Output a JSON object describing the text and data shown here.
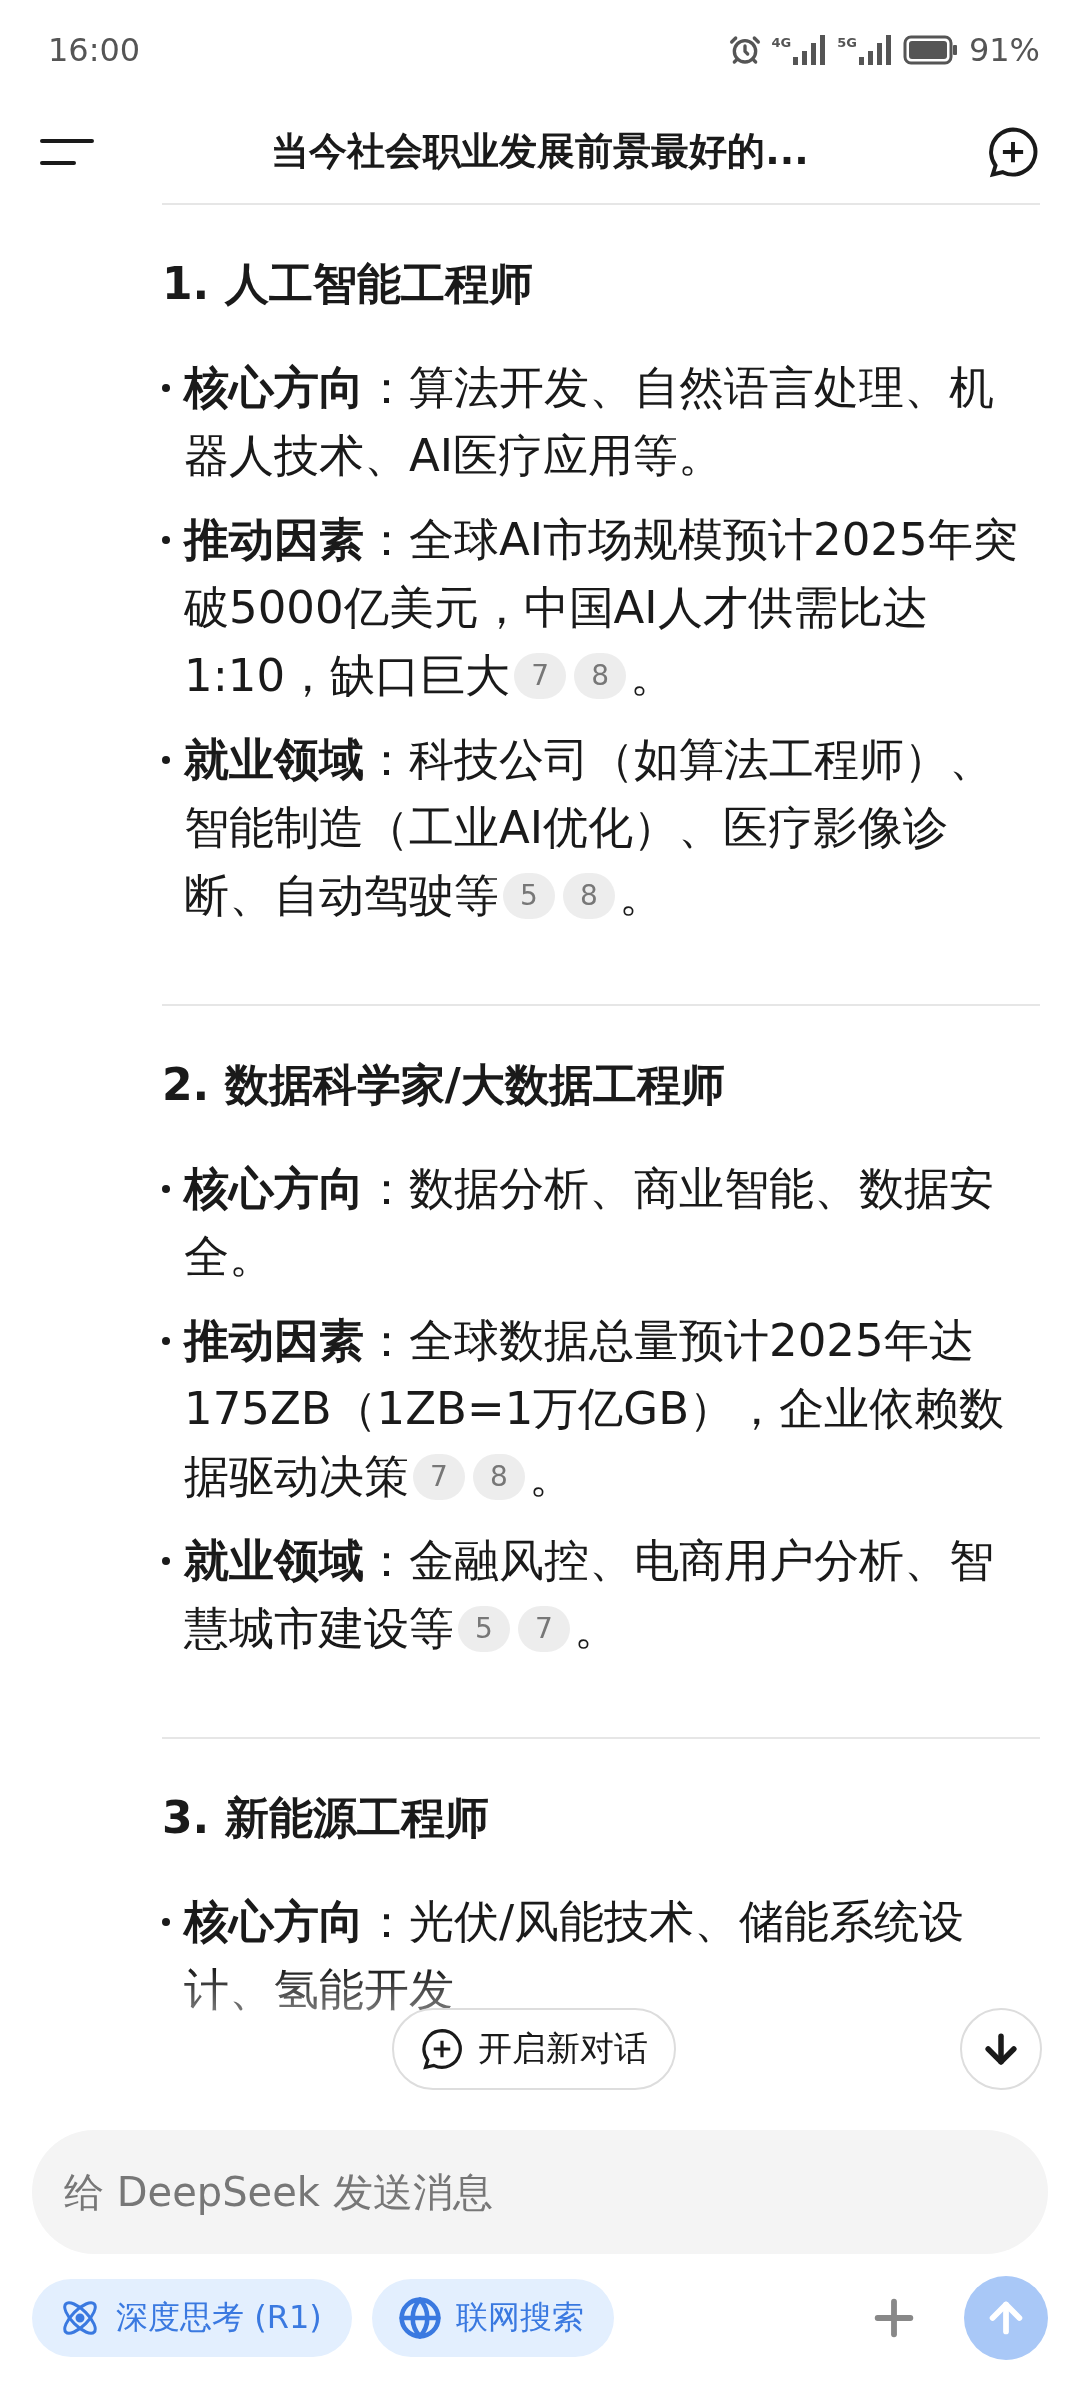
{
  "status_bar": {
    "time": "16:00",
    "signals": [
      {
        "label": "4G"
      },
      {
        "label": "5G"
      }
    ],
    "battery": "91%"
  },
  "header": {
    "title": "当今社会职业发展前景最好的..."
  },
  "sections": [
    {
      "heading": "1. 人工智能工程师",
      "items": [
        {
          "label": "核心方向",
          "text": "：算法开发、自然语言处理、机器人技术、AI医疗应用等。"
        },
        {
          "label": "推动因素",
          "text": "：全球AI市场规模预计2025年突破5000亿美元，中国AI人才供需比达1:10，缺口巨大",
          "citations": [
            "7",
            "8"
          ],
          "tail": "。"
        },
        {
          "label": "就业领域",
          "text": "：科技公司（如算法工程师）、智能制造（工业AI优化）、医疗影像诊断、自动驾驶等",
          "citations": [
            "5",
            "8"
          ],
          "tail": "。"
        }
      ]
    },
    {
      "heading": "2. 数据科学家/大数据工程师",
      "items": [
        {
          "label": "核心方向",
          "text": "：数据分析、商业智能、数据安全。"
        },
        {
          "label": "推动因素",
          "text": "：全球数据总量预计2025年达175ZB（1ZB=1万亿GB），企业依赖数据驱动决策",
          "citations": [
            "7",
            "8"
          ],
          "tail": "。"
        },
        {
          "label": "就业领域",
          "text": "：金融风控、电商用户分析、智慧城市建设等",
          "citations": [
            "5",
            "7"
          ],
          "tail": "。"
        }
      ]
    },
    {
      "heading": "3. 新能源工程师",
      "items": [
        {
          "label": "核心方向",
          "text": "：光伏/风能技术、储能系统设计、氢能开发"
        }
      ]
    }
  ],
  "new_chat_button": "开启新对话",
  "composer": {
    "placeholder": "给 DeepSeek 发送消息",
    "chips": [
      {
        "kind": "deepthink",
        "label": "深度思考 (R1)",
        "selected": false
      },
      {
        "kind": "search",
        "label": "联网搜索",
        "selected": false
      }
    ]
  }
}
